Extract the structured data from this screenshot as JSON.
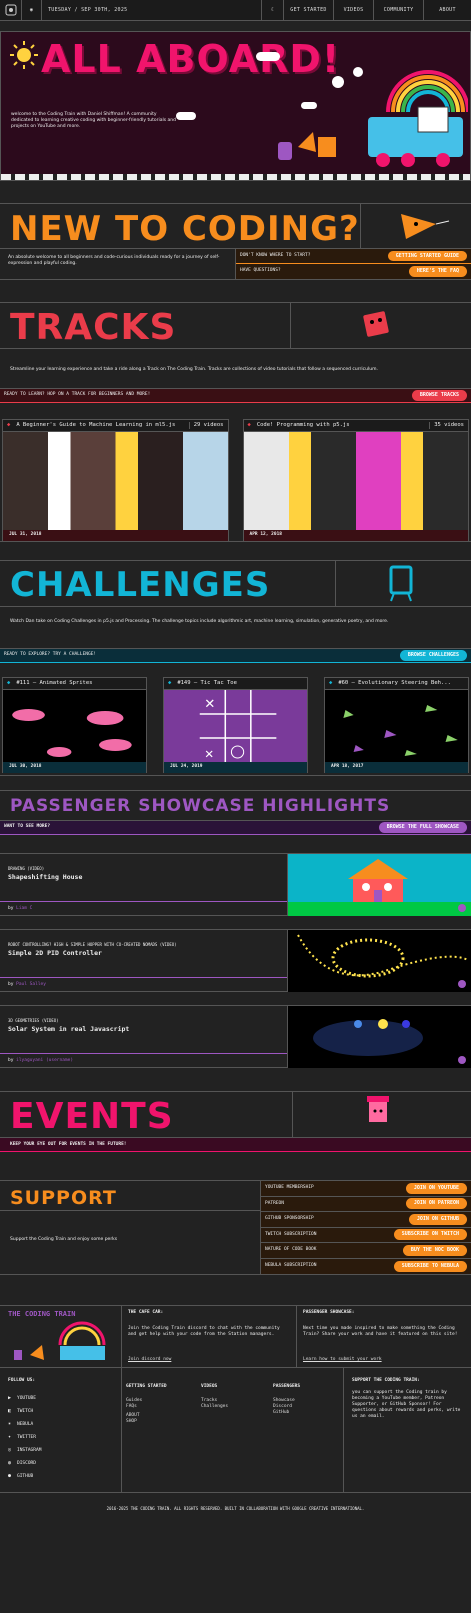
{
  "nav": {
    "date": "TUESDAY / SEP 30TH, 2025",
    "links": [
      "GET STARTED",
      "VIDEOS",
      "COMMUNITY",
      "ABOUT"
    ]
  },
  "hero": {
    "title": "ALL ABOARD!",
    "text": "welcome to the Coding Train with Daniel Shiffman! A community dedicated to learning creative coding with beginner-friendly tutorials and projects on YouTube and more."
  },
  "newc": {
    "title": "NEW TO CODING?",
    "text": "An absolute welcome to all beginners and code-curious individuals ready for a journey of self-expression and playful coding.",
    "q1": "DON'T KNOW WHERE TO START?",
    "b1": "GETTING STARTED GUIDE",
    "q2": "HAVE QUESTIONS?",
    "b2": "HERE'S THE FAQ"
  },
  "tracks": {
    "title": "TRACKS",
    "text": "Streamline your learning experience and take a ride along a Track on The Coding Train. Tracks are collections of video tutorials that follow a sequenced curriculum.",
    "cta": "READY TO LEARN? HOP ON A TRACK FOR BEGINNERS AND MORE!",
    "btn": "BROWSE TRACKS",
    "cards": [
      {
        "title": "A Beginner's Guide to Machine Learning in ml5.js",
        "count": "29 videos",
        "date": "JUL 31, 2018"
      },
      {
        "title": "Code! Programming with p5.js",
        "count": "35 videos",
        "date": "APR 12, 2018"
      }
    ]
  },
  "challenges": {
    "title": "CHALLENGES",
    "text": "Watch Dan take on Coding Challenges in p5.js and Processing. The challenge topics include algorithmic art, machine learning, simulation, generative poetry, and more.",
    "cta": "READY TO EXPLORE? TRY A CHALLENGE!",
    "btn": "BROWSE CHALLENGES",
    "cards": [
      {
        "title": "#111 — Animated Sprites",
        "date": "JUL 30, 2018"
      },
      {
        "title": "#149 — Tic Tac Toe",
        "date": "JUL 24, 2019"
      },
      {
        "title": "#60 — Evolutionary Steering Beh...",
        "date": "APR 18, 2017"
      }
    ]
  },
  "showcase": {
    "title": "PASSENGER SHOWCASE HIGHLIGHTS",
    "cta": "WANT TO SEE MORE?",
    "btn": "BROWSE THE FULL SHOWCASE",
    "items": [
      {
        "ctx": "DRAWING (VIDEO)",
        "title": "Shapeshifting House",
        "by": "by",
        "author": "Liam C"
      },
      {
        "ctx": "ROBOT CONTROLLING? HIGH & SIMPLE HOPPER WITH CO-CREATED NOMADS (VIDEO)",
        "title": "Simple 2D PID Controller",
        "by": "by",
        "author": "Paul Salley"
      },
      {
        "ctx": "3D GEOMETRIES (VIDEO)",
        "title": "Solar System in real Javascript",
        "by": "by",
        "author": "ilyaguyani (username)"
      }
    ]
  },
  "events": {
    "title": "EVENTS",
    "cta": "KEEP YOUR EYE OUT FOR EVENTS IN THE FUTURE!"
  },
  "support": {
    "title": "SUPPORT",
    "text": "Support the Coding Train and enjoy some perks",
    "rows": [
      {
        "l": "YOUTUBE MEMBERSHIP",
        "b": "JOIN ON YOUTUBE"
      },
      {
        "l": "PATREON",
        "b": "JOIN ON PATREON"
      },
      {
        "l": "GITHUB SPONSORSHIP",
        "b": "JOIN ON GITHUB"
      },
      {
        "l": "TWITCH SUBSCRIPTION",
        "b": "SUBSCRIBE ON TWITCH"
      },
      {
        "l": "NATURE OF CODE BOOK",
        "b": "BUY THE NOC BOOK"
      },
      {
        "l": "NEBULA SUBSCRIPTION",
        "b": "SUBSCRIBE TO NEBULA"
      }
    ]
  },
  "footer": {
    "brand": "THE CODING TRAIN",
    "cafe_h": "THE CAFE CAR:",
    "cafe_t": "Join the Coding Train discord to chat with the community and get help with your code from the Station managers.",
    "cafe_l": "Join discord now",
    "pass_h": "PASSENGER SHOWCASE:",
    "pass_t": "Next time you made inspired to make something the Coding Train? Share your work and have it featured on this site!",
    "pass_l": "Learn how to submit your work",
    "follow_h": "FOLLOW US:",
    "social": [
      "YOUTUBE",
      "TWITCH",
      "NEBULA",
      "TWITTER",
      "INSTAGRAM",
      "DISCORD",
      "GITHUB"
    ],
    "gs_h": "GETTING STARTED",
    "gs": [
      "Guides",
      "FAQs",
      "ABOUT",
      "SHOP"
    ],
    "v_h": "VIDEOS",
    "v": [
      "Tracks",
      "Challenges"
    ],
    "p_h": "PASSENGERS",
    "p": [
      "Showcase",
      "Discord",
      "GitHub"
    ],
    "sup_h": "SUPPORT THE CODING TRAIN:",
    "sup_t": "you can support the Coding train by becoming a YouTube member, Patreon Supporter, or GitHub Sponsor! For questions about rewards and perks, write us an email.",
    "copy": "2016-2025 THE CODING TRAIN. ALL RIGHTS RESERVED. BUILT IN COLLABORATION WITH GOOGLE CREATIVE INTERNATIONAL."
  },
  "colors": {
    "pink": "#f0146c",
    "orange": "#f78d1e",
    "red": "#ea3c4a",
    "cyan": "#12b5d6",
    "purple": "#9e57c2"
  }
}
